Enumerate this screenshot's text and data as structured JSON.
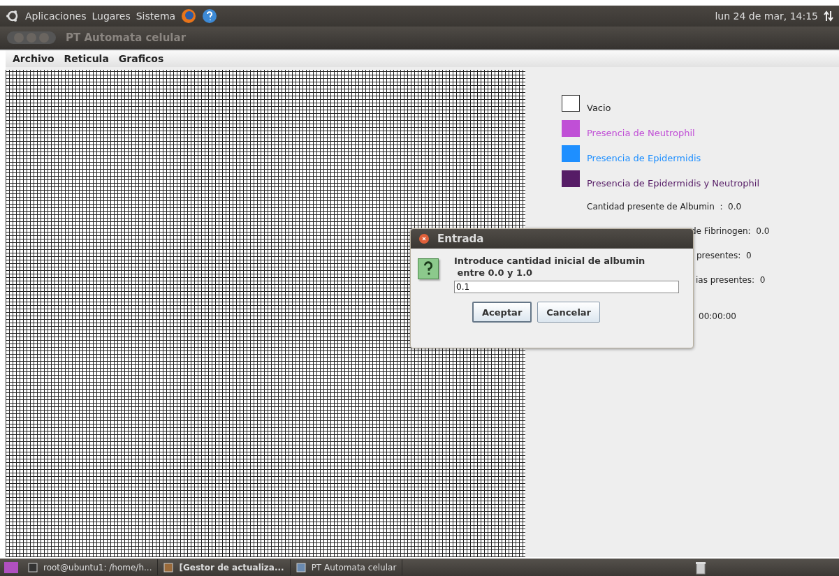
{
  "top_panel": {
    "menus": [
      "Aplicaciones",
      "Lugares",
      "Sistema"
    ],
    "clock": "lun 24 de mar, 14:15"
  },
  "window": {
    "title": "PT Automata celular"
  },
  "menubar": [
    "Archivo",
    "Reticula",
    "Graficos"
  ],
  "legend": [
    {
      "label": "Vacio",
      "color": "#ffffff"
    },
    {
      "label": "Presencia de Neutrophil",
      "color": "#c04fd6"
    },
    {
      "label": "Presencia de Epidermidis",
      "color": "#1e8fff"
    },
    {
      "label": "Presencia de Epidermidis y Neutrophil",
      "color": "#561c66"
    }
  ],
  "stats": [
    "Cantidad presente de Albumin  :  0.0",
    "de Fibrinogen:  0.0",
    "presentes:  0",
    "ias presentes:  0",
    "00:00:00"
  ],
  "dialog": {
    "title": "Entrada",
    "message": "Introduce cantidad inicial de albumin",
    "message_2": " entre 0.0 y 1.0",
    "value": "0.1",
    "buttons": [
      {
        "label": "Aceptar",
        "selected": true
      },
      {
        "label": "Cancelar",
        "selected": false
      }
    ]
  },
  "taskbar": [
    {
      "label": "root@ubuntu1: /home/h...",
      "bold": false
    },
    {
      "label": "[Gestor de actualiza...",
      "bold": true
    },
    {
      "label": "PT Automata celular",
      "bold": false
    }
  ]
}
